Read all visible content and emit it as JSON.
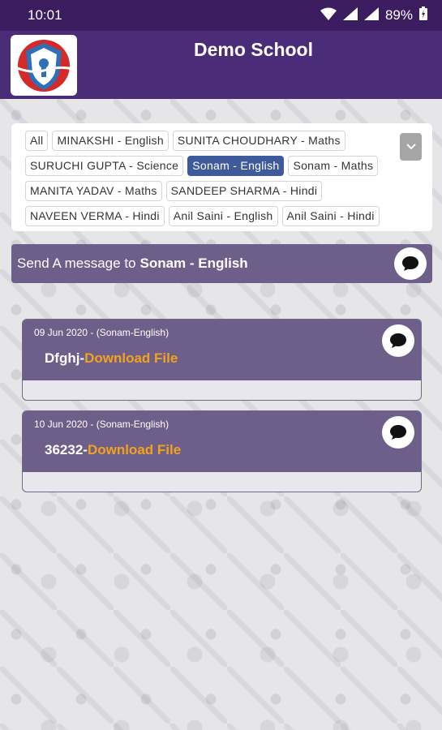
{
  "status_bar": {
    "time": "10:01",
    "battery": "89%"
  },
  "app_bar": {
    "title": "Demo School",
    "logo_icon": "school-shield-logo"
  },
  "chips": {
    "rows": [
      [
        {
          "label": "All"
        },
        {
          "label": "MINAKSHI - English"
        },
        {
          "label": "SUNITA CHOUDHARY - Maths"
        }
      ],
      [
        {
          "label": "SURUCHI GUPTA - Science"
        },
        {
          "label": "Sonam - English",
          "selected": true
        },
        {
          "label": "Sonam - Maths"
        }
      ],
      [
        {
          "label": "MANITA YADAV - Maths"
        },
        {
          "label": "SANDEEP SHARMA - Hindi"
        }
      ],
      [
        {
          "label": "NAVEEN VERMA - Hindi"
        },
        {
          "label": "Anil Saini - English"
        },
        {
          "label": "Anil Saini - Hindi"
        }
      ]
    ],
    "dropdown_icon": "chevron-down-icon"
  },
  "send_bar": {
    "prefix": "Send A message to",
    "recipient": "Sonam - English",
    "icon": "chat-bubble-icon"
  },
  "messages": [
    {
      "date": "09 Jun 2020 - (Sonam-English)",
      "text": "Dfghj-",
      "link": "Download File"
    },
    {
      "date": "10 Jun 2020 - (Sonam-English)",
      "text": "36232-",
      "link": "Download File"
    }
  ],
  "colors": {
    "status_bar": "#3a1c5f",
    "app_bar": "#4a2c79",
    "card": "#6d5f8a",
    "selected_chip": "#3f5a9a",
    "link": "#f3a21d"
  }
}
